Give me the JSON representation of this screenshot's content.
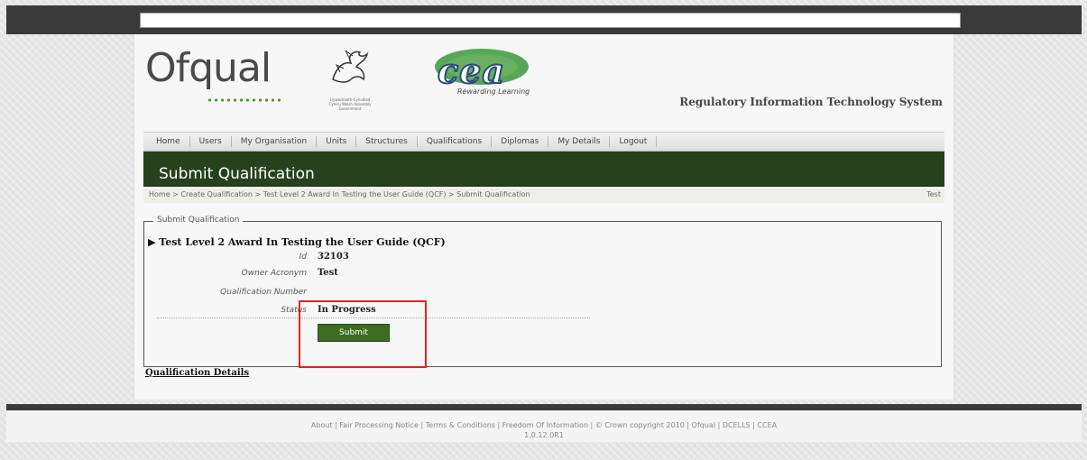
{
  "browser": {
    "address_text": ""
  },
  "header": {
    "logos": {
      "ofqual": "Ofqual",
      "wales": "Llywodraeth Cynulliad Cymru Welsh Assembly Government",
      "cea": "CEA",
      "cea_tagline": "Rewarding Learning"
    },
    "system_title": "Regulatory Information Technology System"
  },
  "nav": {
    "items": [
      "Home",
      "Users",
      "My Organisation",
      "Units",
      "Structures",
      "Qualifications",
      "Diplomas",
      "My Details",
      "Logout"
    ]
  },
  "page": {
    "title": "Submit Qualification",
    "breadcrumb": "Home > Create Qualification > Test Level 2 Award In Testing the User Guide (QCF) > Submit Qualification",
    "breadcrumb_right": "Test"
  },
  "form": {
    "legend": "Submit Qualification",
    "qualification_title": "▶ Test Level 2 Award In Testing the User Guide (QCF)",
    "fields": [
      {
        "label": "Id",
        "value": "32103"
      },
      {
        "label": "Owner Acronym",
        "value": "Test"
      },
      {
        "label": "Qualification Number",
        "value": ""
      },
      {
        "label": "Status",
        "value": "In Progress"
      }
    ],
    "submit_label": "Submit"
  },
  "links": {
    "qualification_details": "Qualification Details"
  },
  "footer": {
    "links": "About | Fair Processing Notice | Terms & Conditions | Freedom Of Information | © Crown copyright 2010 | Ofqual | DCELLS | CCEA",
    "version": "1.0.12.0R1"
  },
  "colors": {
    "title_bar": "#26421c",
    "button": "#3c6d22",
    "highlight": "#e02424"
  }
}
